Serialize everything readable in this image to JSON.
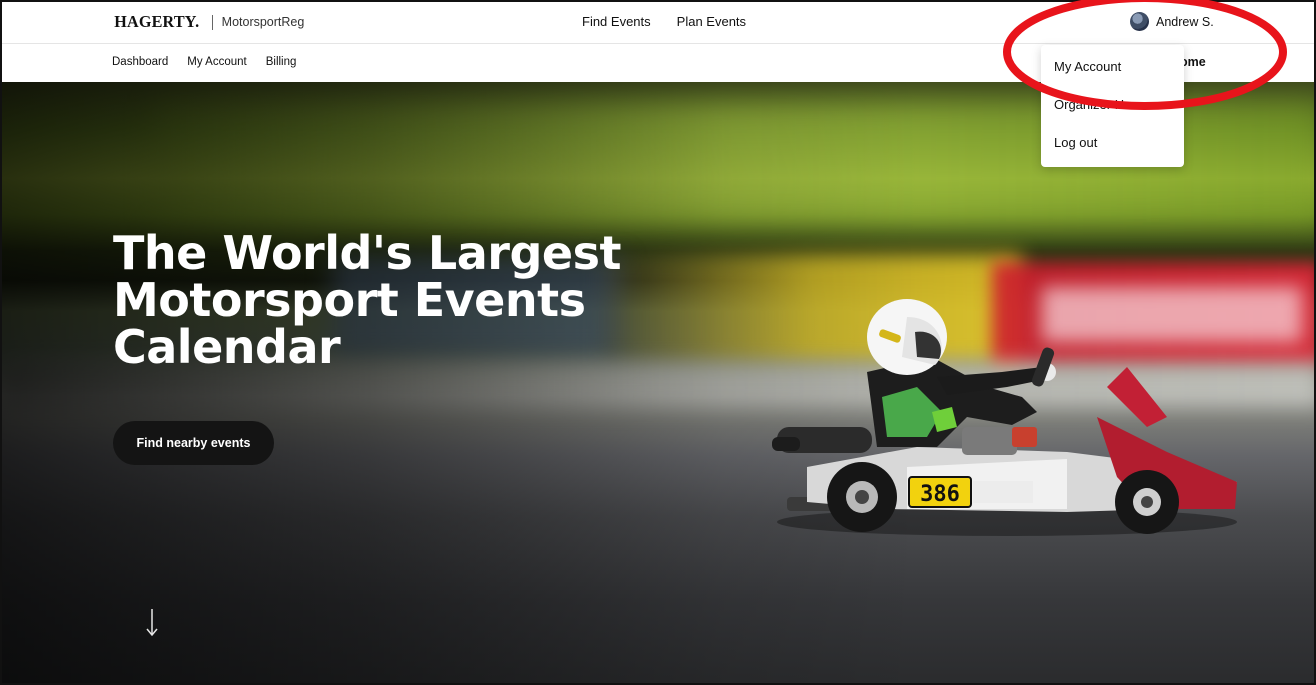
{
  "brand": {
    "logo": "HAGERTY.",
    "name": "MotorsportReg"
  },
  "main_nav": {
    "find_events": "Find Events",
    "plan_events": "Plan Events"
  },
  "user": {
    "name": "Andrew S."
  },
  "sub_nav": {
    "dashboard": "Dashboard",
    "my_account": "My Account",
    "billing": "Billing",
    "right_partial": "ome"
  },
  "dropdown": {
    "items": [
      {
        "label": "My Account"
      },
      {
        "label": "Organizer Home"
      },
      {
        "label": "Log out"
      }
    ]
  },
  "hero": {
    "title": "The World's Largest Motorsport Events Calendar",
    "cta": "Find nearby events",
    "kart_number": "386"
  },
  "colors": {
    "annotation": "#e8141b",
    "button_bg": "#141414",
    "text": "#111111"
  }
}
